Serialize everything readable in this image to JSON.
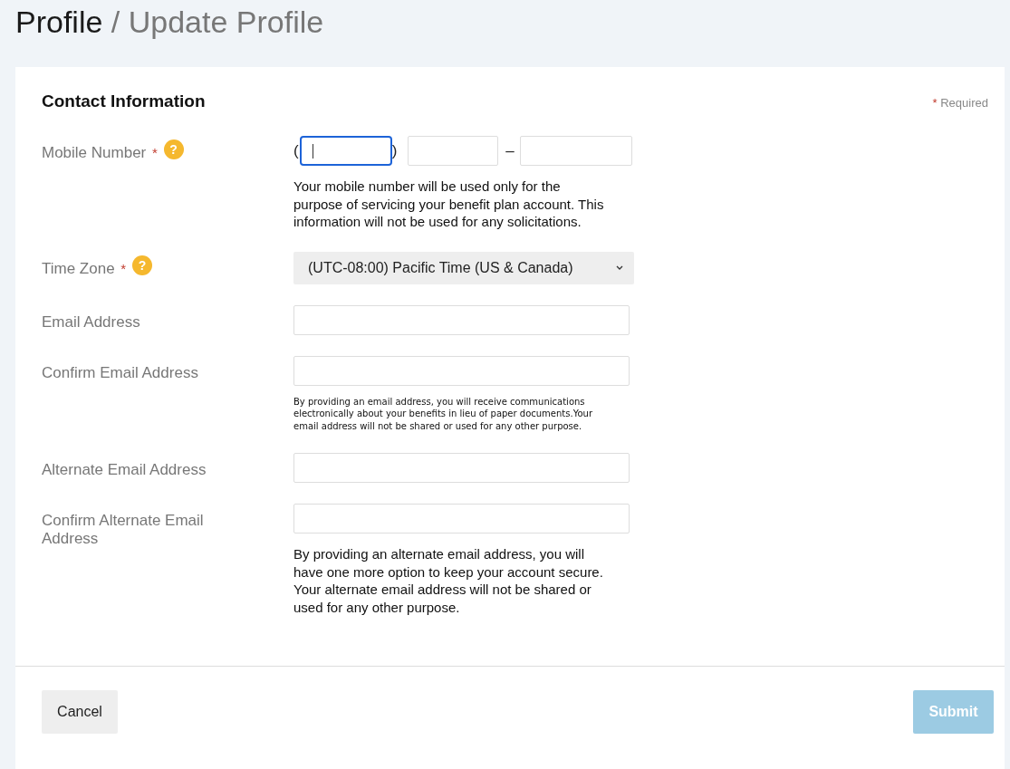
{
  "breadcrumb": {
    "parent": "Profile",
    "separator": "/",
    "current": "Update Profile"
  },
  "section": {
    "title": "Contact Information",
    "required_note": {
      "mark": "*",
      "text": "Required"
    }
  },
  "fields": [
    {
      "kind": "phone",
      "label": "Mobile Number",
      "required_mark": "*",
      "help": "?",
      "open_paren": "(",
      "close_paren": ")",
      "dash": "–",
      "parts": [
        {
          "focused": true
        },
        {
          "focused": false
        },
        {
          "focused": false
        }
      ],
      "note": {
        "kind": "regular",
        "text": "Your mobile number will be used only for the purpose of servicing your benefit plan account. This information will not be used for any solicitations."
      }
    },
    {
      "kind": "select",
      "label": "Time Zone",
      "required_mark": "*",
      "help": "?",
      "value": "(UTC-08:00) Pacific Time (US & Canada)"
    },
    {
      "kind": "text",
      "label": "Email Address"
    },
    {
      "kind": "text",
      "label": "Confirm Email Address",
      "note": {
        "kind": "fine",
        "text": "By providing an email address, you will receive communications electronically about your benefits in lieu of paper documents.Your email address will not be shared or used for any other purpose."
      }
    },
    {
      "kind": "text",
      "label": "Alternate Email Address"
    },
    {
      "kind": "text",
      "label": "Confirm Alternate Email Address",
      "note": {
        "kind": "regular",
        "text": "By providing an alternate email address, you will have one more option to keep your account secure. Your alternate email address will not be shared or used for any other purpose."
      }
    }
  ],
  "buttons": [
    {
      "label": "Cancel",
      "kind": "secondary",
      "disabled": false
    },
    {
      "label": "Submit",
      "kind": "primary",
      "disabled": true
    }
  ]
}
